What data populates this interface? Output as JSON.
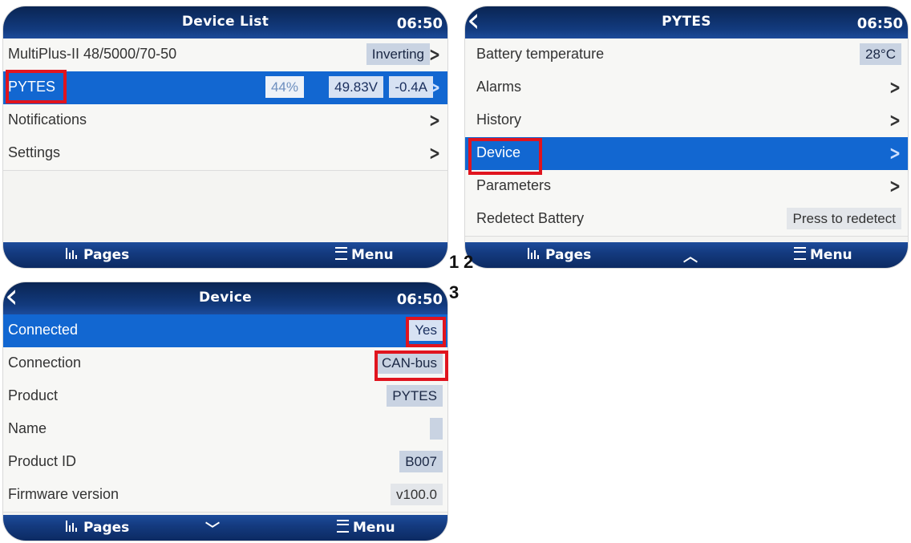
{
  "screen1": {
    "title": "Device List",
    "time": "06:50",
    "rows": [
      {
        "label": "MultiPlus-II 48/5000/70-50",
        "value": "Inverting"
      },
      {
        "label": "PYTES",
        "soc": "44%",
        "voltage": "49.83V",
        "current": "-0.4A"
      },
      {
        "label": "Notifications"
      },
      {
        "label": "Settings"
      }
    ],
    "footer": {
      "pages": "Pages",
      "menu": "Menu"
    }
  },
  "screen2": {
    "title": "PYTES",
    "time": "06:50",
    "rows": [
      {
        "label": "Battery temperature",
        "value": "28°C"
      },
      {
        "label": "Alarms"
      },
      {
        "label": "History"
      },
      {
        "label": "Device"
      },
      {
        "label": "Parameters"
      },
      {
        "label": "Redetect Battery",
        "value": "Press to redetect"
      }
    ],
    "footer": {
      "pages": "Pages",
      "menu": "Menu"
    }
  },
  "screen3": {
    "title": "Device",
    "time": "06:50",
    "rows": [
      {
        "label": "Connected",
        "value": "Yes"
      },
      {
        "label": "Connection",
        "value": "CAN-bus"
      },
      {
        "label": "Product",
        "value": "PYTES"
      },
      {
        "label": "Name",
        "value": ""
      },
      {
        "label": "Product ID",
        "value": "B007"
      },
      {
        "label": "Firmware version",
        "value": "v100.0"
      }
    ],
    "footer": {
      "pages": "Pages",
      "menu": "Menu"
    }
  },
  "step_labels": {
    "one": "1",
    "two": "2",
    "three": "3"
  },
  "colors": {
    "highlight": "#1267d1",
    "header": "#0a2553",
    "marker": "#e0141e"
  }
}
